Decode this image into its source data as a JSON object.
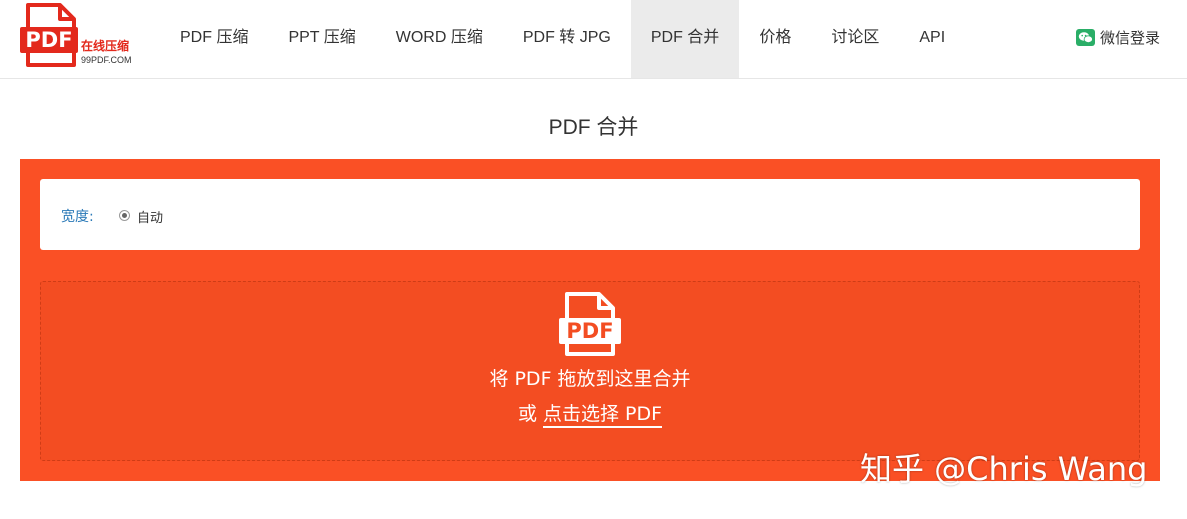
{
  "logo": {
    "badge": "PDF",
    "cn_text": "在线压缩",
    "domain": "99PDF.COM"
  },
  "nav": {
    "items": [
      {
        "label": "PDF 压缩"
      },
      {
        "label": "PPT 压缩"
      },
      {
        "label": "WORD 压缩"
      },
      {
        "label": "PDF 转 JPG"
      },
      {
        "label": "PDF 合并"
      },
      {
        "label": "价格"
      },
      {
        "label": "讨论区"
      },
      {
        "label": "API"
      }
    ],
    "active_index": 4
  },
  "wechat_login": {
    "label": "微信登录",
    "icon": "wechat-icon",
    "color": "#2aae67"
  },
  "page_title": "PDF 合并",
  "options": {
    "width_label": "宽度:",
    "width_option": "自动",
    "width_selected": true
  },
  "dropzone": {
    "icon": "pdf-file-icon",
    "icon_text": "PDF",
    "line1": "将 PDF 拖放到这里合并",
    "or_text": "或",
    "select_link": "点击选择 PDF"
  },
  "watermark": "知乎 @Chris Wang",
  "colors": {
    "accent": "#fa5025",
    "dropzone_bg": "#f34d22",
    "brand_red": "#e3291c",
    "label_blue": "#2b7ab8",
    "active_nav_bg": "#ebebeb"
  }
}
